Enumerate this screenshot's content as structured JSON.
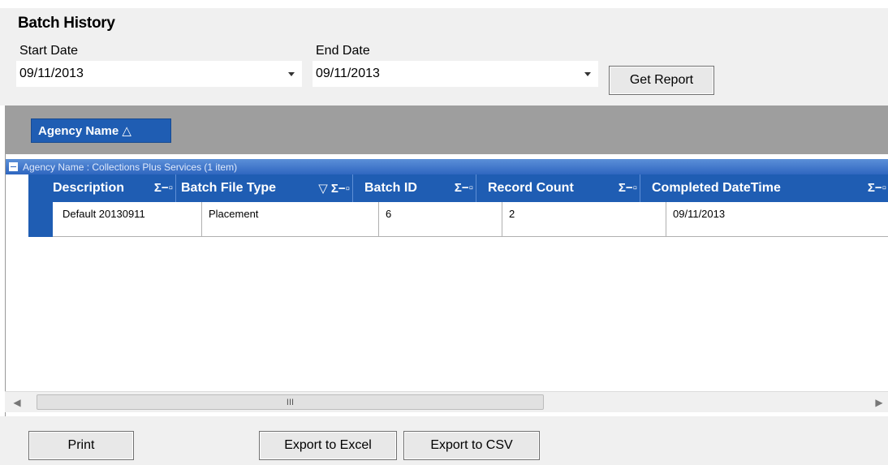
{
  "title": "Batch History",
  "start_date": {
    "label": "Start Date",
    "value": "09/11/2013"
  },
  "end_date": {
    "label": "End Date",
    "value": "09/11/2013"
  },
  "get_report_label": "Get Report",
  "group_panel": {
    "chip_label": "Agency Name △"
  },
  "group_row": {
    "text": "Agency Name : Collections Plus Services (1 item)"
  },
  "columns": [
    {
      "label": "Description",
      "icons": "Σ−▫"
    },
    {
      "label": "Batch File Type",
      "icons": "▽ Σ−▫"
    },
    {
      "label": "Batch ID",
      "icons": "Σ−▫"
    },
    {
      "label": "Record Count",
      "icons": "Σ−▫"
    },
    {
      "label": "Completed DateTime",
      "icons": "Σ−▫"
    }
  ],
  "rows": [
    {
      "cells": [
        "Default 20130911",
        "Placement",
        "6",
        "2",
        "09/11/2013"
      ]
    }
  ],
  "scrollbar": {
    "thumb_grip": "III"
  },
  "buttons": {
    "print": "Print",
    "export_excel": "Export to Excel",
    "export_csv": "Export to CSV"
  }
}
